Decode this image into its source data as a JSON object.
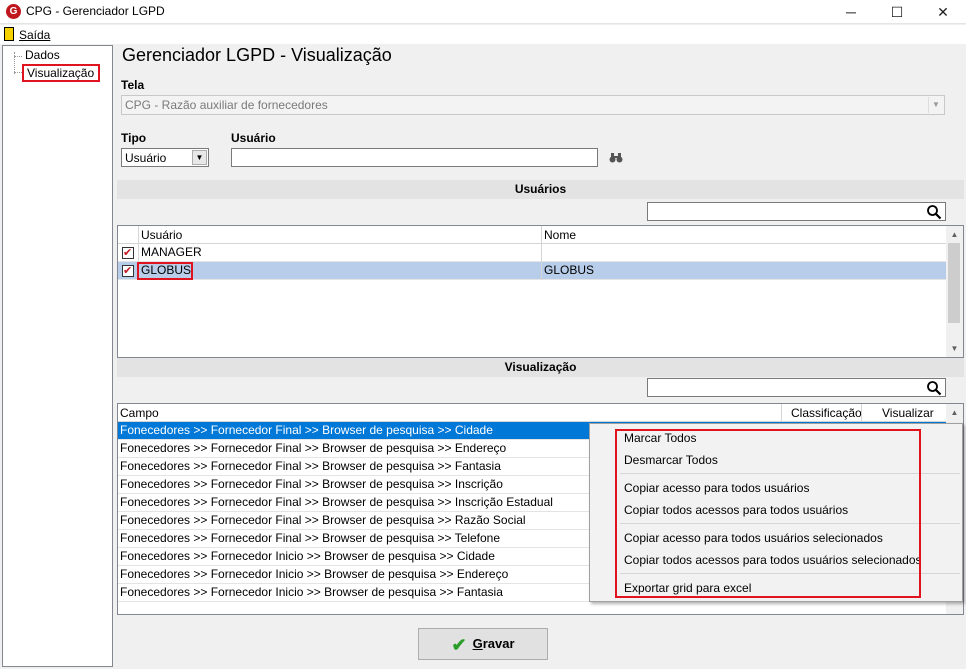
{
  "window": {
    "title": "CPG - Gerenciador LGPD",
    "icon_letter": "G",
    "minimize": "─",
    "maximize": "☐",
    "close": "✕"
  },
  "menu": {
    "exit_label": "Saída"
  },
  "tree": {
    "items": [
      {
        "label": "Dados"
      },
      {
        "label": "Visualização"
      }
    ]
  },
  "page": {
    "title": "Gerenciador LGPD - Visualização"
  },
  "form": {
    "tela_label": "Tela",
    "tela_value": "CPG - Razão auxiliar de fornecedores",
    "tipo_label": "Tipo",
    "tipo_value": "Usuário",
    "usuario_label": "Usuário",
    "usuario_value": ""
  },
  "users_section": {
    "title": "Usuários",
    "search_value": "",
    "columns": [
      "Usuário",
      "Nome"
    ],
    "rows": [
      {
        "usuario": "MANAGER",
        "nome": "",
        "checked": true
      },
      {
        "usuario": "GLOBUS",
        "nome": "GLOBUS",
        "checked": true
      }
    ]
  },
  "vis_section": {
    "title": "Visualização",
    "search_value": "",
    "columns": [
      "Campo",
      "Classificação",
      "Visualizar"
    ],
    "rows": [
      "Fonecedores >> Fornecedor  Final >> Browser de pesquisa >> Cidade",
      "Fonecedores >> Fornecedor  Final >> Browser de pesquisa >> Endereço",
      "Fonecedores >> Fornecedor  Final >> Browser de pesquisa >> Fantasia",
      "Fonecedores >> Fornecedor  Final >> Browser de pesquisa >> Inscrição",
      "Fonecedores >> Fornecedor  Final >> Browser de pesquisa >> Inscrição Estadual",
      "Fonecedores >> Fornecedor  Final >> Browser de pesquisa >> Razão Social",
      "Fonecedores >> Fornecedor  Final >> Browser de pesquisa >> Telefone",
      "Fonecedores >> Fornecedor  Inicio >> Browser de pesquisa >> Cidade",
      "Fonecedores >> Fornecedor  Inicio >> Browser de pesquisa >> Endereço",
      "Fonecedores >> Fornecedor  Inicio >> Browser de pesquisa >> Fantasia"
    ]
  },
  "context_menu": {
    "items": [
      "Marcar Todos",
      "Desmarcar Todos",
      "Copiar acesso para todos usuários",
      "Copiar todos acessos para todos usuários",
      "Copiar acesso para todos usuários selecionados",
      "Copiar todos acessos para todos usuários selecionados",
      "Exportar grid para excel"
    ]
  },
  "footer": {
    "save_label_first": "G",
    "save_label_rest": "ravar"
  },
  "colors": {
    "highlight_red": "#e0141e",
    "selection_blue": "#0078d7",
    "row_selected": "#b8cde9"
  }
}
